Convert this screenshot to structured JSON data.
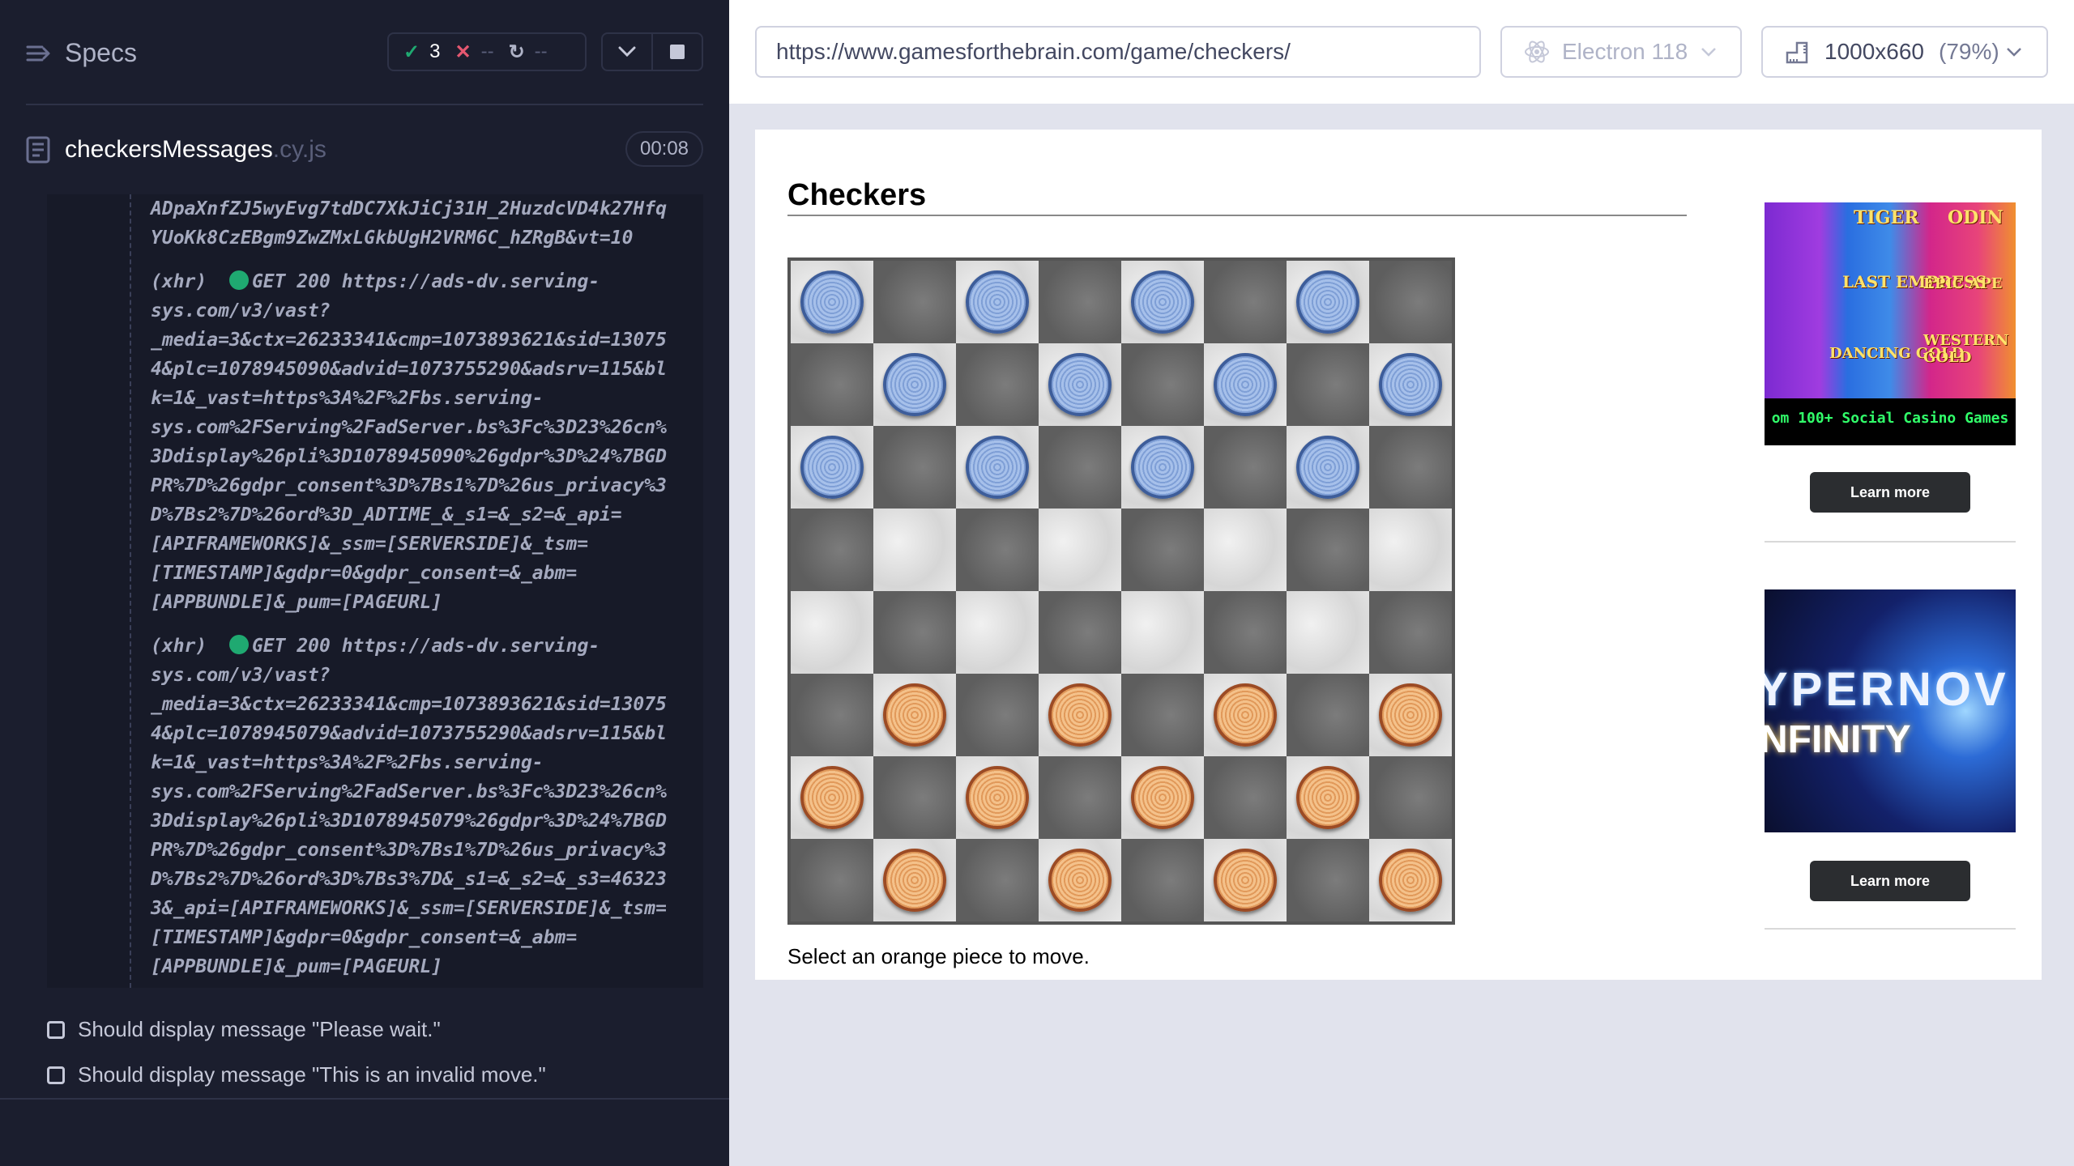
{
  "runner": {
    "specs_title": "Specs",
    "stats": {
      "passed": "3",
      "failed": "--",
      "pending": "--"
    },
    "spec_file": {
      "name": "checkersMessages",
      "ext": ".cy.js",
      "duration": "00:08"
    },
    "log": {
      "lines_top": "ADpaXnfZJ5wyEvg7tdDC7XkJiCj31H_2HuzdcVD4k27Hfq\nYUoKk8CzEBgm9ZwZMxLGkbUgH2VRM6C_hZRgB&vt=10",
      "entry1_head": "(xhr)  ",
      "entry1_req": "GET 200 https://ads-dv.serving-",
      "entry1_body": "sys.com/v3/vast?\n_media=3&ctx=26233341&cmp=1073893621&sid=13075\n4&plc=1078945090&advid=1073755290&adsrv=115&bl\nk=1&_vast=https%3A%2F%2Fbs.serving-\nsys.com%2FServing%2FadServer.bs%3Fc%3D23%26cn%\n3Ddisplay%26pli%3D1078945090%26gdpr%3D%24%7BGD\nPR%7D%26gdpr_consent%3D%7Bs1%7D%26us_privacy%3\nD%7Bs2%7D%26ord%3D_ADTIME_&_s1=&_s2=&_api=\n[APIFRAMEWORKS]&_ssm=[SERVERSIDE]&_tsm=\n[TIMESTAMP]&gdpr=0&gdpr_consent=&_abm=\n[APPBUNDLE]&_pum=[PAGEURL]",
      "entry2_head": "(xhr)  ",
      "entry2_req": "GET 200 https://ads-dv.serving-",
      "entry2_body": "sys.com/v3/vast?\n_media=3&ctx=26233341&cmp=1073893621&sid=13075\n4&plc=1078945079&advid=1073755290&adsrv=115&bl\nk=1&_vast=https%3A%2F%2Fbs.serving-\nsys.com%2FServing%2FadServer.bs%3Fc%3D23%26cn%\n3Ddisplay%26pli%3D1078945079%26gdpr%3D%24%7BGD\nPR%7D%26gdpr_consent%3D%7Bs1%7D%26us_privacy%3\nD%7Bs2%7D%26ord%3D%7Bs3%7D&_s1=&_s2=&_s3=46323\n3&_api=[APIFRAMEWORKS]&_ssm=[SERVERSIDE]&_tsm=\n[TIMESTAMP]&gdpr=0&gdpr_consent=&_abm=\n[APPBUNDLE]&_pum=[PAGEURL]"
    },
    "tests": [
      "Should display message \"Please wait.\"",
      "Should display message \"This is an invalid move.\""
    ]
  },
  "toolbar": {
    "url": "https://www.gamesforthebrain.com/game/checkers/",
    "browser": "Electron 118",
    "viewport": "1000x660",
    "viewport_pct": "(79%)"
  },
  "game": {
    "title": "Checkers",
    "status": "Select an orange piece to move.",
    "board": [
      "b.b.b.b.",
      ".b.b.b.b",
      "b.b.b.b.",
      "........",
      "........",
      ".o.o.o.o",
      "o.o.o.o.",
      ".o.o.o.o"
    ]
  },
  "ads": [
    {
      "banner_text": "om 100+ Social Casino Games",
      "slot_labels": [
        "TIGER",
        "ODIN",
        "LAST EMPRESS",
        "EPIC APE",
        "DANCING GOLD",
        "WESTERN GOLD"
      ],
      "button": "Learn more"
    },
    {
      "title_line1": "YPERNOV",
      "title_line2": "NFINITY",
      "button": "Learn more"
    }
  ],
  "colors": {
    "panel_bg": "#1b1e2e",
    "pass": "#1fa971",
    "fail": "#e45770"
  }
}
